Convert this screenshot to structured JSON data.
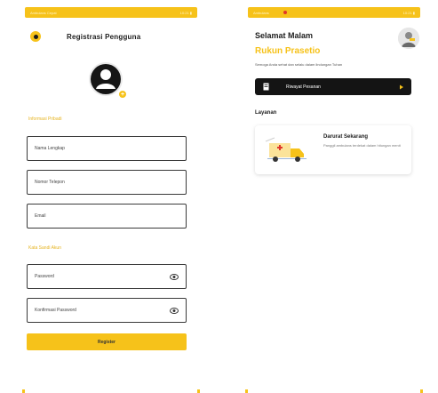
{
  "colors": {
    "accent": "#f6c21a",
    "dark": "#141414",
    "label": "#e6b422"
  },
  "left_screen": {
    "status_bar": {
      "left": "Ambulans Cepat",
      "right": "10:21 ▮"
    },
    "header": {
      "title": "Registrasi Pengguna",
      "menu_icon": "menu-circle-icon"
    },
    "avatar": {
      "icon": "user-avatar-icon",
      "badge_icon": "plus-icon",
      "badge_text": "+"
    },
    "sections": {
      "personal": "Informasi Pribadi",
      "security": "Kata Sandi Akun"
    },
    "fields": {
      "full_name": "Nama Lengkap",
      "phone": "Nomor Telepon",
      "email": "Email",
      "password": "Password",
      "confirm_password": "Konfirmasi Password"
    },
    "register_button": "Register"
  },
  "right_screen": {
    "status_bar": {
      "left": "Ambulans",
      "right": "10:21 ▮"
    },
    "greeting": "Selamat Malam",
    "username": "Rukun Prasetio",
    "subtitle": "Semoga Anda sehat dan selalu dalam lindungan Tuhan",
    "history_button": "Riwayat Pesanan",
    "services_title": "Layanan",
    "service_card": {
      "title": "Darurat Sekarang",
      "description": "Panggil ambulans terdekat dalam hitungan menit"
    }
  }
}
